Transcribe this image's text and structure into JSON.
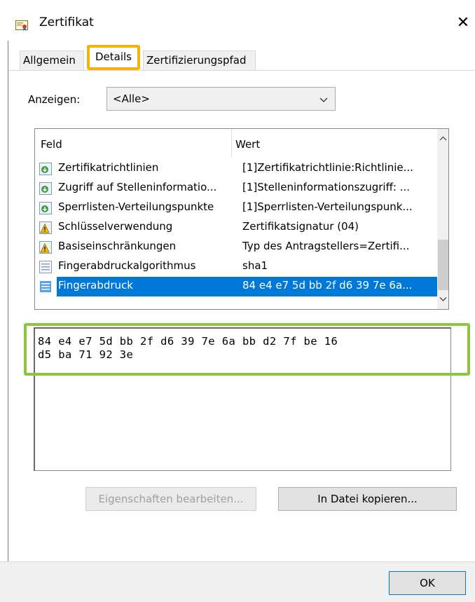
{
  "window": {
    "title": "Zertifikat",
    "close_glyph": "✕"
  },
  "tabs": [
    {
      "label": "Allgemein"
    },
    {
      "label": "Details"
    },
    {
      "label": "Zertifizierungspfad"
    }
  ],
  "show": {
    "label": "Anzeigen:",
    "value": "<Alle>"
  },
  "list": {
    "columns": {
      "feld": "Feld",
      "wert": "Wert"
    },
    "rows": [
      {
        "feld": "Zertifikatrichtlinien",
        "wert": "[1]Zertifikatrichtlinie:Richtlinie...",
        "icon": "extension-icon"
      },
      {
        "feld": "Zugriff auf Stelleninformatio...",
        "wert": "[1]Stelleninformationszugriff: ...",
        "icon": "extension-icon"
      },
      {
        "feld": "Sperrlisten-Verteilungspunkte",
        "wert": "[1]Sperrlisten-Verteilungspunk...",
        "icon": "extension-icon"
      },
      {
        "feld": "Schlüsselverwendung",
        "wert": "Zertifikatsignatur (04)",
        "icon": "critical-extension-icon"
      },
      {
        "feld": "Basiseinschränkungen",
        "wert": "Typ des Antragstellers=Zertifi...",
        "icon": "critical-extension-icon"
      },
      {
        "feld": "Fingerabdruckalgorithmus",
        "wert": "sha1",
        "icon": "property-icon"
      },
      {
        "feld": "Fingerabdruck",
        "wert": "84 e4 e7 5d bb 2f d6 39 7e 6a...",
        "icon": "property-icon",
        "selected": true
      }
    ]
  },
  "value_text": "84 e4 e7 5d bb 2f d6 39 7e 6a bb d2 7f be 16\nd5 ba 71 92 3e",
  "buttons": {
    "edit": "Eigenschaften bearbeiten...",
    "copy": "In Datei kopieren...",
    "ok": "OK"
  },
  "colors": {
    "selection": "#0078d7",
    "tab_highlight": "#f4b400",
    "value_highlight": "#8cc63f"
  }
}
